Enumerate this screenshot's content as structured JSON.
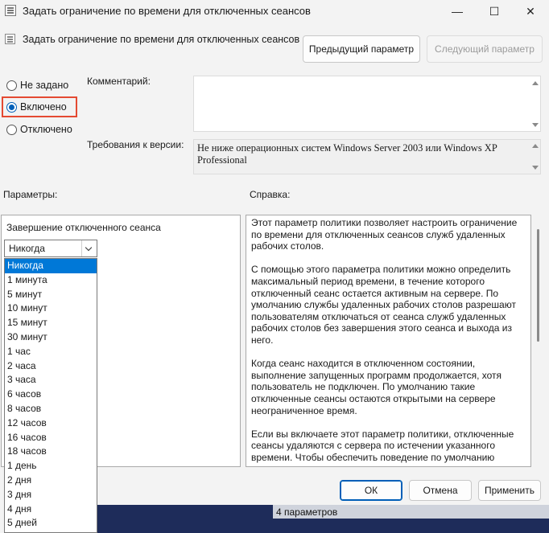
{
  "window": {
    "title": "Задать ограничение по времени для отключенных сеансов",
    "minimize": "—",
    "maximize": "☐",
    "close": "✕"
  },
  "header": {
    "setting_title": "Задать ограничение по времени для отключенных сеансов",
    "prev_button": "Предыдущий параметр",
    "next_button": "Следующий параметр"
  },
  "state": {
    "options": [
      {
        "label": "Не задано",
        "checked": false
      },
      {
        "label": "Включено",
        "checked": true
      },
      {
        "label": "Отключено",
        "checked": false
      }
    ]
  },
  "comment": {
    "label": "Комментарий:",
    "value": ""
  },
  "requirements": {
    "label": "Требования к версии:",
    "value": "Не ниже операционных систем Windows Server 2003 или Windows XP Professional"
  },
  "sections": {
    "params_label": "Параметры:",
    "help_label": "Справка:"
  },
  "params": {
    "field_label": "Завершение отключенного сеанса",
    "selected": "Никогда",
    "options": [
      "Никогда",
      "1 минута",
      "5 минут",
      "10 минут",
      "15 минут",
      "30 минут",
      "1 час",
      "2 часа",
      "3 часа",
      "6 часов",
      "8 часов",
      "12 часов",
      "16 часов",
      "18 часов",
      "1 день",
      "2 дня",
      "3 дня",
      "4 дня",
      "5 дней"
    ]
  },
  "help": {
    "paragraphs": [
      "Этот параметр политики позволяет настроить ограничение по времени для отключенных сеансов служб удаленных рабочих столов.",
      "С помощью этого параметра политики можно определить максимальный период времени, в течение которого отключенный сеанс остается активным на сервере. По умолчанию службы удаленных рабочих столов разрешают пользователям отключаться от сеанса служб удаленных рабочих столов без завершения этого сеанса и выхода из него.",
      "Когда сеанс находится в отключенном состоянии, выполнение запущенных программ продолжается, хотя пользователь не подключен. По умолчанию такие отключенные сеансы остаются открытыми на сервере неограниченное время.",
      "Если вы включаете этот параметр политики, отключенные сеансы удаляются с сервера по истечении указанного времени. Чтобы обеспечить поведение по умолчанию"
    ]
  },
  "footer": {
    "ok": "ОК",
    "cancel": "Отмена",
    "apply": "Применить"
  },
  "status": {
    "text": "4 параметров"
  },
  "colors": {
    "accent": "#005fb8",
    "highlight_box": "#e44a32",
    "selection": "#0078d7"
  }
}
